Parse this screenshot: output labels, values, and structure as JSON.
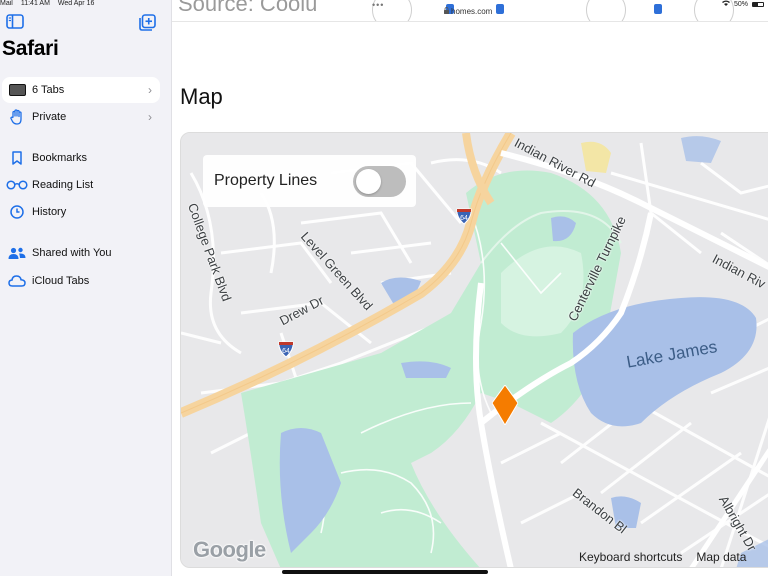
{
  "status_bar": {
    "back_app": "Mail",
    "time": "11:41 AM",
    "date": "Wed Apr 16",
    "battery": "50%",
    "battery_level": 0.5
  },
  "sidebar": {
    "title": "Safari",
    "groups": [
      {
        "label": "6 Tabs",
        "icon": "tabs-icon",
        "selected": true,
        "has_chevron": true
      },
      {
        "label": "Private",
        "icon": "hand-icon",
        "selected": false,
        "has_chevron": true
      }
    ],
    "library": [
      {
        "label": "Bookmarks",
        "icon": "bookmark-icon"
      },
      {
        "label": "Reading List",
        "icon": "glasses-icon"
      },
      {
        "label": "History",
        "icon": "clock-icon"
      }
    ],
    "shared": [
      {
        "label": "Shared with You",
        "icon": "people-icon"
      },
      {
        "label": "iCloud Tabs",
        "icon": "cloud-icon"
      }
    ]
  },
  "browser": {
    "url": "homes.com",
    "partial_heading": "Source: Coolu"
  },
  "page": {
    "heading": "Map"
  },
  "map": {
    "property_lines": {
      "label": "Property Lines",
      "enabled": false
    },
    "roads": [
      "Indian River Rd",
      "College Park Blvd",
      "Level Green Blvd",
      "Drew Dr",
      "Centerville Turnpike",
      "Indian Riv",
      "Brandon Bl",
      "Albright Dr"
    ],
    "lake": "Lake James",
    "highway_shields": [
      "64",
      "64"
    ],
    "logo": "Google",
    "keyboard_shortcuts": "Keyboard shortcuts",
    "map_data": "Map data",
    "colors": {
      "park": "#c1ecd2",
      "water": "#a9c0e8",
      "highway": "#f6d49e",
      "marker": "#f57c00",
      "land": "#e8e8ea"
    }
  }
}
